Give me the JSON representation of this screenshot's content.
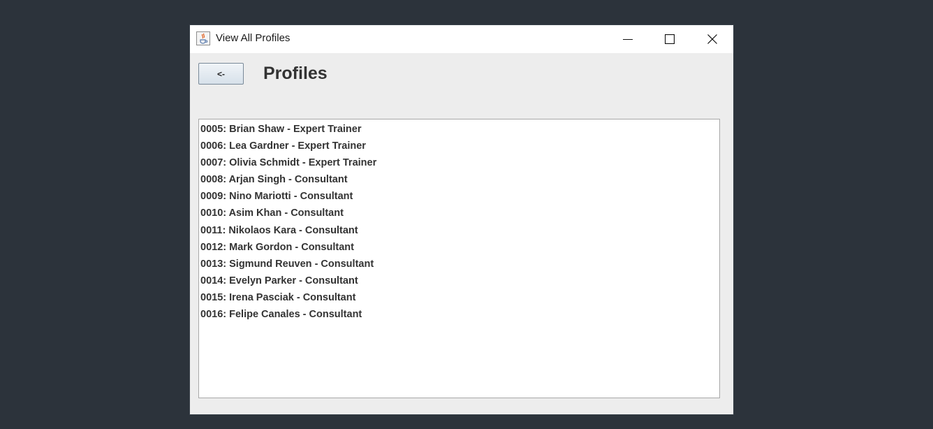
{
  "window": {
    "title": "View All Profiles",
    "app_icon": "java-cup-icon",
    "controls": {
      "minimize": "minimize-icon",
      "maximize": "maximize-icon",
      "close": "close-icon"
    }
  },
  "header": {
    "back_label": "<-",
    "title": "Profiles"
  },
  "profiles": [
    "0005: Brian Shaw - Expert Trainer",
    "0006: Lea Gardner - Expert Trainer",
    "0007: Olivia Schmidt - Expert Trainer",
    "0008: Arjan Singh - Consultant",
    "0009: Nino Mariotti - Consultant",
    "0010: Asim Khan - Consultant",
    "0011: Nikolaos Kara - Consultant",
    "0012: Mark Gordon - Consultant",
    "0013: Sigmund Reuven - Consultant",
    "0014: Evelyn Parker - Consultant",
    "0015: Irena Pasciak - Consultant",
    "0016: Felipe Canales - Consultant"
  ]
}
